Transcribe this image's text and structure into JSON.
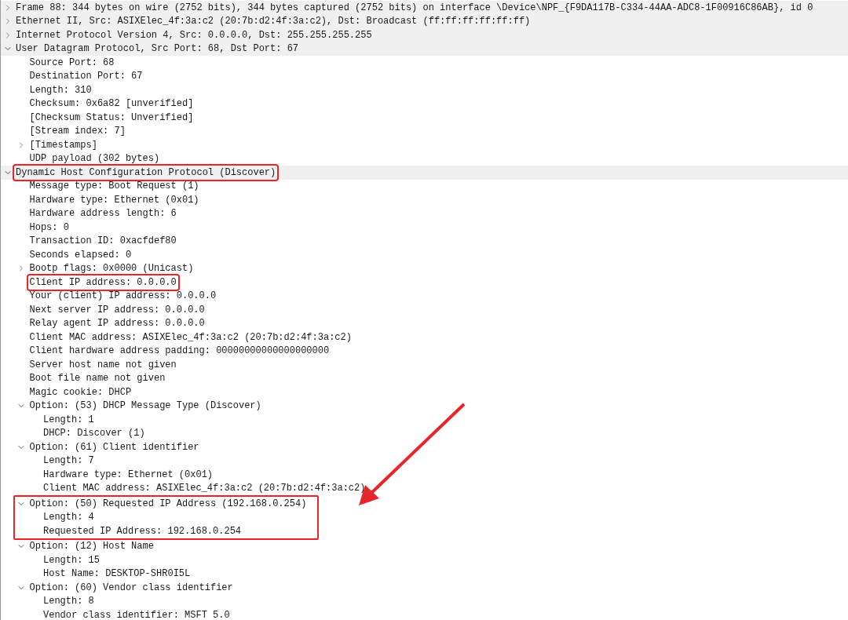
{
  "tree": [
    {
      "label": "Frame 88: 344 bytes on wire (2752 bits), 344 bytes captured (2752 bits) on interface \\Device\\NPF_{F9DA117B-C334-44AA-ADC8-1F00916C86AB}, id 0",
      "expanded": false
    },
    {
      "label": "Ethernet II, Src: ASIXElec_4f:3a:c2 (20:7b:d2:4f:3a:c2), Dst: Broadcast (ff:ff:ff:ff:ff:ff)",
      "expanded": false
    },
    {
      "label": "Internet Protocol Version 4, Src: 0.0.0.0, Dst: 255.255.255.255",
      "expanded": false
    },
    {
      "label": "User Datagram Protocol, Src Port: 68, Dst Port: 67",
      "expanded": true,
      "children": [
        {
          "label": "Source Port: 68"
        },
        {
          "label": "Destination Port: 67"
        },
        {
          "label": "Length: 310"
        },
        {
          "label": "Checksum: 0x6a82 [unverified]"
        },
        {
          "label": "[Checksum Status: Unverified]"
        },
        {
          "label": "[Stream index: 7]"
        },
        {
          "label": "[Timestamps]",
          "expanded": false
        },
        {
          "label": "UDP payload (302 bytes)"
        }
      ]
    },
    {
      "label": "Dynamic Host Configuration Protocol (Discover)",
      "expanded": true,
      "highlighted": true,
      "children": [
        {
          "label": "Message type: Boot Request (1)"
        },
        {
          "label": "Hardware type: Ethernet (0x01)"
        },
        {
          "label": "Hardware address length: 6"
        },
        {
          "label": "Hops: 0"
        },
        {
          "label": "Transaction ID: 0xacfdef80"
        },
        {
          "label": "Seconds elapsed: 0"
        },
        {
          "label": "Bootp flags: 0x0000 (Unicast)",
          "expanded": false
        },
        {
          "label": "Client IP address: 0.0.0.0",
          "highlighted": true
        },
        {
          "label": "Your (client) IP address: 0.0.0.0"
        },
        {
          "label": "Next server IP address: 0.0.0.0"
        },
        {
          "label": "Relay agent IP address: 0.0.0.0"
        },
        {
          "label": "Client MAC address: ASIXElec_4f:3a:c2 (20:7b:d2:4f:3a:c2)"
        },
        {
          "label": "Client hardware address padding: 00000000000000000000"
        },
        {
          "label": "Server host name not given"
        },
        {
          "label": "Boot file name not given"
        },
        {
          "label": "Magic cookie: DHCP"
        },
        {
          "label": "Option: (53) DHCP Message Type (Discover)",
          "expanded": true,
          "children": [
            {
              "label": "Length: 1"
            },
            {
              "label": "DHCP: Discover (1)"
            }
          ]
        },
        {
          "label": "Option: (61) Client identifier",
          "expanded": true,
          "children": [
            {
              "label": "Length: 7"
            },
            {
              "label": "Hardware type: Ethernet (0x01)"
            },
            {
              "label": "Client MAC address: ASIXElec_4f:3a:c2 (20:7b:d2:4f:3a:c2)"
            }
          ]
        },
        {
          "label": "Option: (50) Requested IP Address (192.168.0.254)",
          "expanded": true,
          "highlighted": true,
          "children": [
            {
              "label": "Length: 4"
            },
            {
              "label": "Requested IP Address: 192.168.0.254"
            }
          ]
        },
        {
          "label": "Option: (12) Host Name",
          "expanded": true,
          "children": [
            {
              "label": "Length: 15"
            },
            {
              "label": "Host Name: DESKTOP-SHR0I5L"
            }
          ]
        },
        {
          "label": "Option: (60) Vendor class identifier",
          "expanded": true,
          "children": [
            {
              "label": "Length: 8"
            },
            {
              "label": "Vendor class identifier: MSFT 5.0"
            }
          ]
        }
      ]
    }
  ]
}
